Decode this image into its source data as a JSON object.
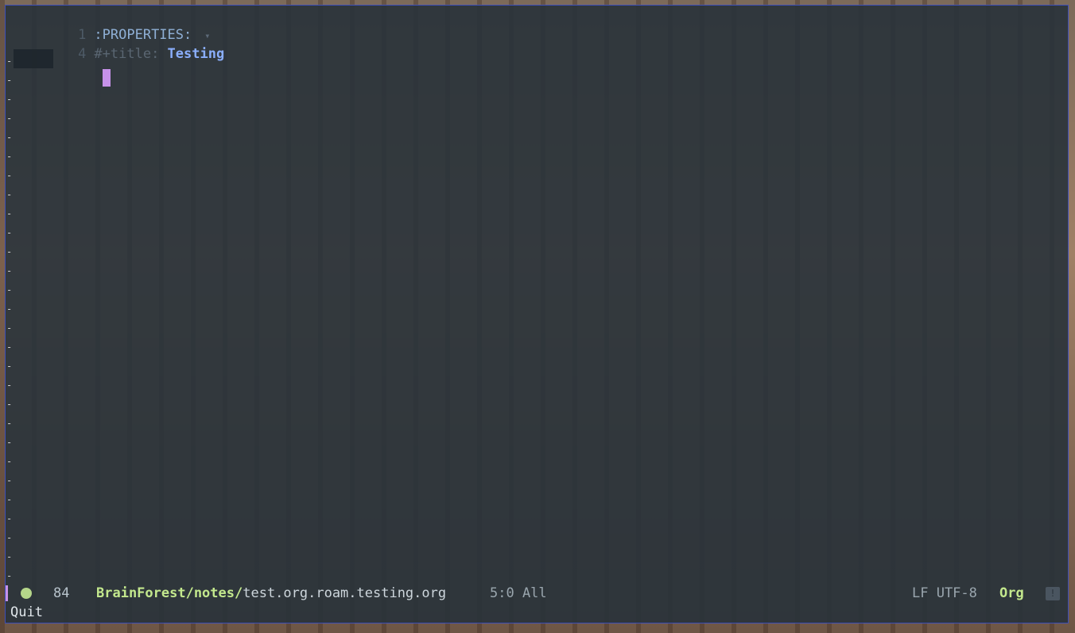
{
  "buffer": {
    "lines": [
      {
        "number": "1",
        "text": ":PROPERTIES:",
        "fold_icon": "▾"
      },
      {
        "number": "4",
        "keyword": "#+title: ",
        "title": "Testing"
      },
      {
        "number": "",
        "text": ""
      }
    ]
  },
  "modeline": {
    "status_dot_color": "#b5d68a",
    "count": "84",
    "dir": "BrainForest/notes/",
    "file": "test.org.roam.testing.org",
    "position": "5:0 All",
    "encoding": "LF UTF-8",
    "mode": "Org",
    "warning_icon": "warning-icon"
  },
  "echo_area": {
    "message": "Quit"
  },
  "colors": {
    "frame_border": "#3e4fb8",
    "cursor": "#c792ea",
    "title": "#8aaefc",
    "dir": "#c3e88d"
  }
}
